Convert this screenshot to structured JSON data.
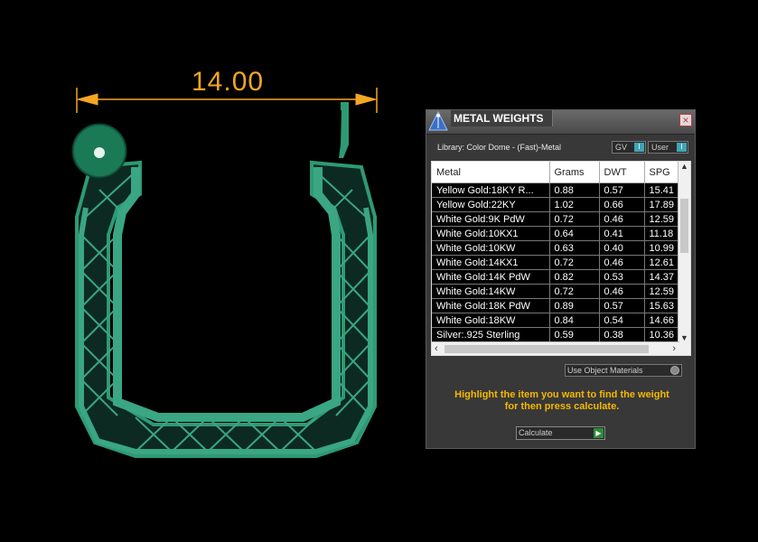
{
  "viewport": {
    "dimension_value": "14.00",
    "accent_color": "#f5a623",
    "model_color": "#2e9a74"
  },
  "panel": {
    "title": "METAL WEIGHTS",
    "close_label": "×",
    "library_label": "Library: Color Dome - (Fast)-Metal",
    "gv_label": "GV",
    "user_label": "User",
    "columns": [
      "Metal",
      "Grams",
      "DWT",
      "SPG"
    ],
    "rows": [
      [
        "Yellow Gold:18KY R...",
        "0.88",
        "0.57",
        "15.41"
      ],
      [
        "Yellow Gold:22KY",
        "1.02",
        "0.66",
        "17.89"
      ],
      [
        "White Gold:9K PdW",
        "0.72",
        "0.46",
        "12.59"
      ],
      [
        "White Gold:10KX1",
        "0.64",
        "0.41",
        "11.18"
      ],
      [
        "White Gold:10KW",
        "0.63",
        "0.40",
        "10.99"
      ],
      [
        "White Gold:14KX1",
        "0.72",
        "0.46",
        "12.61"
      ],
      [
        "White Gold:14K PdW",
        "0.82",
        "0.53",
        "14.37"
      ],
      [
        "White Gold:14KW",
        "0.72",
        "0.46",
        "12.59"
      ],
      [
        "White Gold:18K PdW",
        "0.89",
        "0.57",
        "15.63"
      ],
      [
        "White Gold:18KW",
        "0.84",
        "0.54",
        "14.66"
      ],
      [
        "Silver:.925 Sterling",
        "0.59",
        "0.38",
        "10.36"
      ]
    ],
    "use_object_materials_label": "Use Object Materials",
    "hint_line1": "Highlight the item you want to find the weight",
    "hint_line2": "for then press calculate.",
    "calculate_label": "Calculate",
    "hint_color": "#f5b800"
  }
}
